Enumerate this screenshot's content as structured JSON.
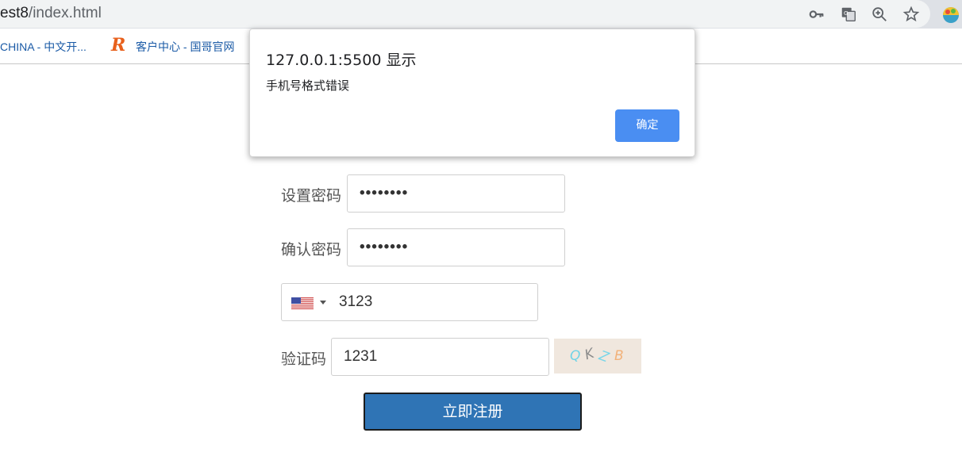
{
  "browser": {
    "url_host": "est8",
    "url_path": "/index.html",
    "bookmarks": [
      {
        "label": "CHINA - 中文开..."
      },
      {
        "label": "客户中心 - 国哥官网"
      }
    ],
    "bookmark_logo": "R"
  },
  "form": {
    "password_label": "设置密码",
    "password_value": "••••••••",
    "confirm_label": "确认密码",
    "confirm_value": "••••••••",
    "phone_value": "3123",
    "phone_country": "US",
    "captcha_label": "验证码",
    "captcha_value": "1231",
    "captcha_chars": [
      "Q",
      "K",
      "Z",
      "B"
    ],
    "submit_label": "立即注册"
  },
  "dialog": {
    "title": "127.0.0.1:5500 显示",
    "message": "手机号格式错误",
    "ok_label": "确定"
  },
  "colors": {
    "accent": "#4a8ef2",
    "submit": "#2f74b5"
  }
}
